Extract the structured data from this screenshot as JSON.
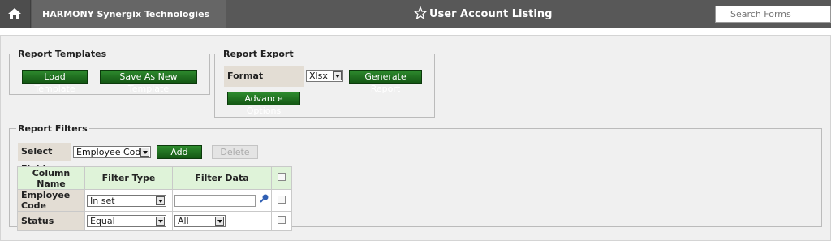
{
  "header": {
    "company": "HARMONY Synergix Technologies Pte Ltd",
    "title": "User Account Listing",
    "search_placeholder": "Search Forms"
  },
  "templates": {
    "legend": "Report Templates",
    "load_label": "Load Template",
    "save_new_label": "Save As New Template"
  },
  "export": {
    "legend": "Report Export",
    "format_label": "Format",
    "format_value": "Xlsx",
    "generate_label": "Generate Report",
    "advance_label": "Advance Options"
  },
  "filters": {
    "legend": "Report Filters",
    "select_field_label": "Select Field",
    "select_field_value": "Employee Code",
    "add_label": "Add",
    "delete_label": "Delete",
    "columns": [
      "Column Name",
      "Filter Type",
      "Filter Data"
    ],
    "rows": [
      {
        "name": "Employee Code",
        "type": "In set",
        "data": ""
      },
      {
        "name": "Status",
        "type": "Equal",
        "data": "All"
      }
    ]
  },
  "colors": {
    "topbar": "#585858",
    "button": "#1c6e1c",
    "header_cell": "#dff3d9",
    "label_cell": "#e3ddd4"
  },
  "icons": [
    "home-icon",
    "star-icon",
    "search-icon",
    "caret-down-icon",
    "lookup-icon"
  ]
}
